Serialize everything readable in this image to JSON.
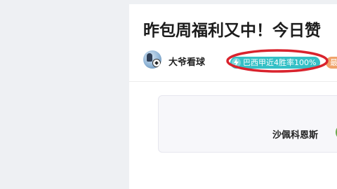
{
  "article": {
    "title": "昨包周福利又中！今日赞"
  },
  "author": {
    "name": "大爷看球",
    "avatar_icon": "soccer-avatar"
  },
  "badges": {
    "primary": {
      "text": "巴西甲近4胜率100%",
      "icon": "lightning-icon",
      "color": "#35c0c6"
    },
    "secondary": {
      "text": "最",
      "color": "#f0a36a"
    }
  },
  "annotation": {
    "color": "#d9232d"
  },
  "match": {
    "team_name": "沙佩科恩斯"
  }
}
